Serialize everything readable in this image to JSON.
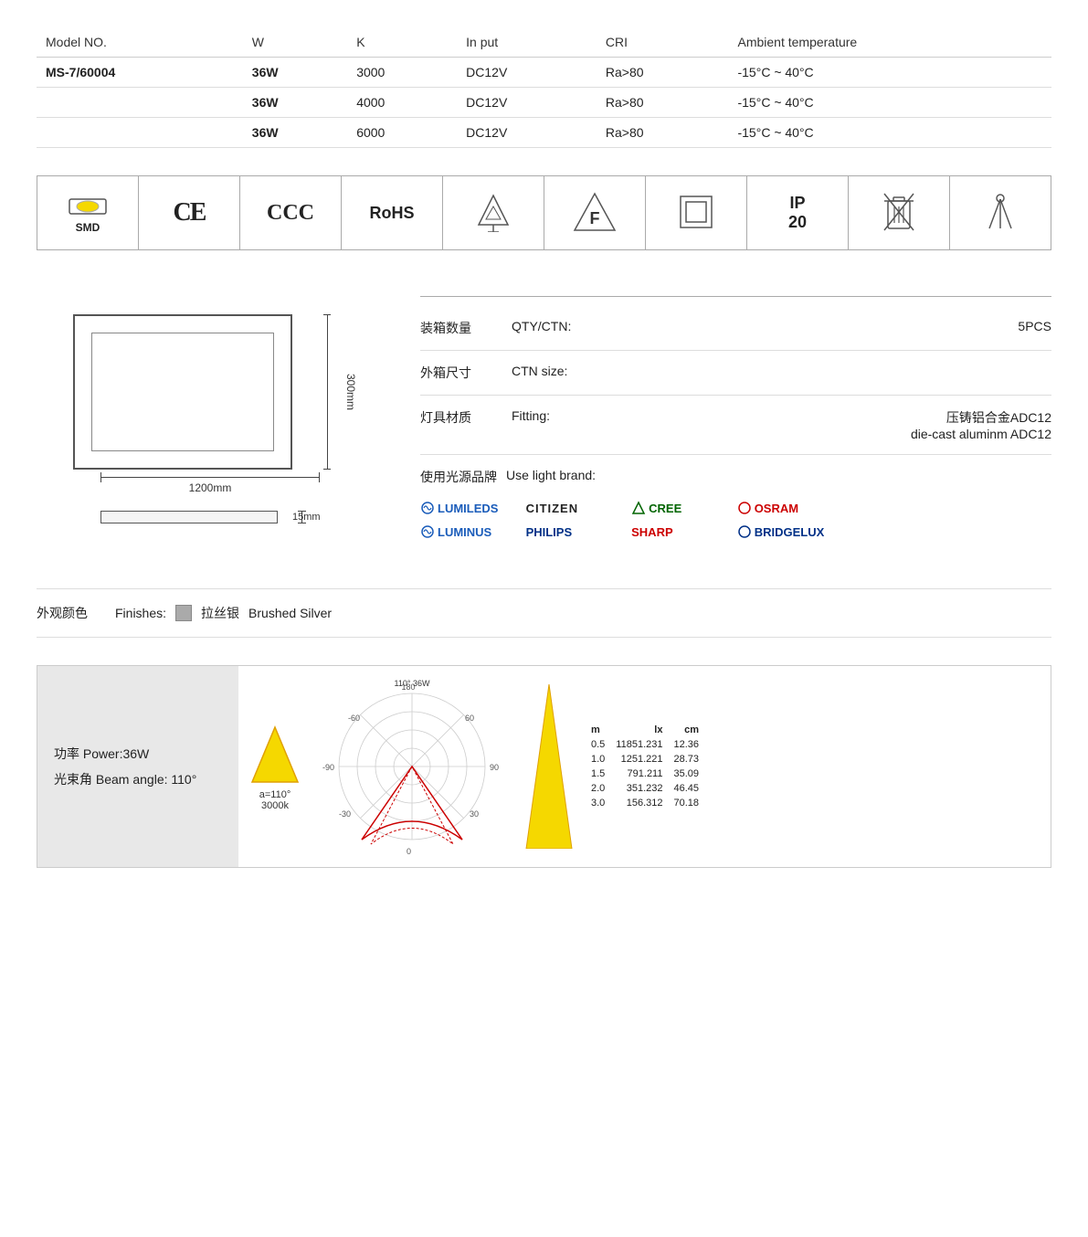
{
  "table": {
    "headers": [
      "Model NO.",
      "W",
      "K",
      "In put",
      "CRI",
      "Ambient temperature"
    ],
    "rows": [
      {
        "model": "MS-7/60004",
        "w": "36W",
        "k": "3000",
        "input": "DC12V",
        "cri": "Ra>80",
        "temp": "-15°C ~ 40°C",
        "isFirst": true
      },
      {
        "model": "",
        "w": "36W",
        "k": "4000",
        "input": "DC12V",
        "cri": "Ra>80",
        "temp": "-15°C ~ 40°C",
        "isFirst": false
      },
      {
        "model": "",
        "w": "36W",
        "k": "6000",
        "input": "DC12V",
        "cri": "Ra>80",
        "temp": "-15°C ~ 40°C",
        "isFirst": false
      }
    ]
  },
  "certifications": [
    "SMD",
    "CE",
    "CCC",
    "RoHS",
    "Export",
    "Class F",
    "Square",
    "IP20",
    "WEEE",
    "Beam"
  ],
  "dimensions": {
    "width": "1200mm",
    "height": "300mm",
    "depth": "15mm"
  },
  "product_info": {
    "qty_label_cn": "装箱数量",
    "qty_label_en": "QTY/CTN:",
    "qty_value": "5PCS",
    "ctn_label_cn": "外箱尺寸",
    "ctn_label_en": "CTN size:",
    "ctn_value": "",
    "fitting_label_cn": "灯具材质",
    "fitting_label_en": "Fitting:",
    "fitting_value_cn": "压铸铝合金ADC12",
    "fitting_value_en": "die-cast aluminm ADC12",
    "brand_label_cn": "使用光源品牌",
    "brand_label_en": "Use light brand:",
    "brands": [
      {
        "name": "LUMILEDS",
        "class": "brand-lumileds"
      },
      {
        "name": "CITIZEN",
        "class": "brand-citizen"
      },
      {
        "name": "CREE",
        "class": "brand-cree"
      },
      {
        "name": "OSRAM",
        "class": "brand-osram"
      },
      {
        "name": "LUMINUS",
        "class": "brand-luminus"
      },
      {
        "name": "PHILIPS",
        "class": "brand-philips"
      },
      {
        "name": "SHARP",
        "class": "brand-sharp"
      },
      {
        "name": "BRIDGELUX",
        "class": "brand-bridgelux"
      }
    ]
  },
  "finishes": {
    "label_cn": "外观颜色",
    "label_en": "Finishes:",
    "value_cn": "拉丝银",
    "value_en": "Brushed Silver"
  },
  "power_info": {
    "power_label": "功率 Power:36W",
    "beam_label": "光束角 Beam angle: 110°"
  },
  "polar_chart": {
    "title": "110°  36W",
    "angle_label": "a=110°",
    "k_label": "3000k",
    "angles": [
      "180",
      "90",
      "-90",
      "-60",
      "60",
      "-30",
      "30",
      "0"
    ]
  },
  "lux_data": {
    "rows": [
      {
        "m": "0.5",
        "lx": "11851.231",
        "cm": "12.36"
      },
      {
        "m": "1.0",
        "lx": "1251.221",
        "cm": "28.73"
      },
      {
        "m": "1.5",
        "lx": "791.211",
        "cm": "35.09"
      },
      {
        "m": "2.0",
        "lx": "351.232",
        "cm": "46.45"
      },
      {
        "m": "3.0",
        "lx": "156.312",
        "cm": "70.18"
      }
    ],
    "header_m": "m",
    "header_lx": "lx",
    "header_cm": "cm"
  }
}
